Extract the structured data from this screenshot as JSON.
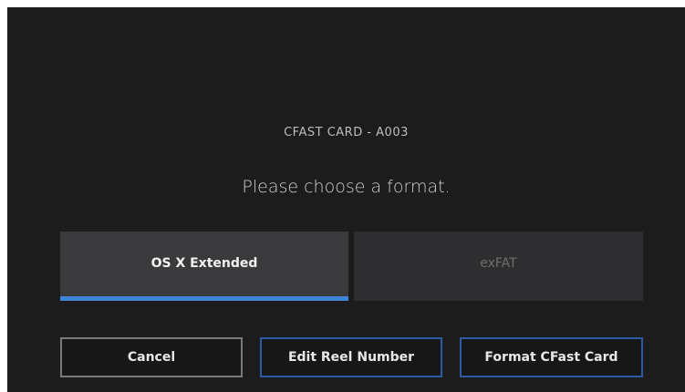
{
  "dialog": {
    "card_title": "CFAST CARD - A003",
    "prompt": "Please choose a format."
  },
  "formats": [
    {
      "label": "OS X Extended",
      "selected": true
    },
    {
      "label": "exFAT",
      "selected": false
    }
  ],
  "buttons": {
    "cancel": "Cancel",
    "edit_reel": "Edit Reel Number",
    "format": "Format CFast Card"
  },
  "colors": {
    "background": "#1c1c1d",
    "selected_tab": "#3a3a3c",
    "unselected_tab": "#2e2e30",
    "accent": "#3f86d6",
    "button_border_primary": "#2d5aa5",
    "button_border_neutral": "#7a7a7a"
  }
}
